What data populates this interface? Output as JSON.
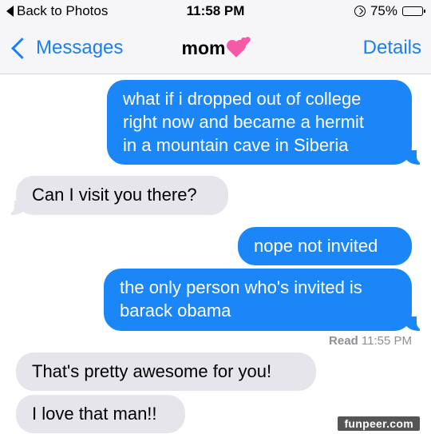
{
  "status_bar": {
    "back_label": "Back to Photos",
    "time": "11:58 PM",
    "battery": "75%",
    "battery_level": 0.75
  },
  "nav": {
    "back_label": "Messages",
    "title": "mom",
    "title_icon": "two-hearts-emoji",
    "details_label": "Details"
  },
  "messages": [
    {
      "from": "me",
      "lines": [
        "what if i dropped out of college",
        "right now and became a hermit",
        "in a mountain cave in Siberia"
      ]
    },
    {
      "from": "mom",
      "lines": [
        "Can I visit you there?"
      ]
    },
    {
      "from": "me",
      "lines": [
        "nope not invited"
      ]
    },
    {
      "from": "me",
      "lines": [
        "the only person who's invited is",
        "barack obama"
      ]
    },
    {
      "from": "mom",
      "lines": [
        "That's pretty awesome for you!"
      ]
    },
    {
      "from": "mom",
      "lines": [
        "I love that man!!"
      ]
    }
  ],
  "read_receipt": {
    "label": "Read",
    "time": "11:55 PM"
  },
  "watermark": "funpeer.com",
  "colors": {
    "accent": "#1a7ef8",
    "outgoing_bubble": "#1a86f7",
    "incoming_bubble": "#e6e5eb",
    "heart": "#f55aa8"
  }
}
